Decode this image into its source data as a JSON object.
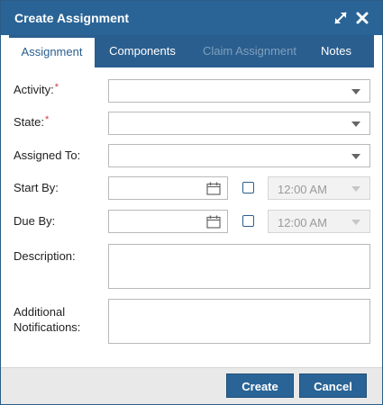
{
  "dialog": {
    "title": "Create Assignment"
  },
  "icons": {
    "maximize": "maximize-icon",
    "close": "close-icon",
    "calendar": "calendar-icon",
    "dropdown": "chevron-down-icon"
  },
  "tabs": [
    {
      "label": "Assignment",
      "state": "active"
    },
    {
      "label": "Components",
      "state": "normal"
    },
    {
      "label": "Claim Assignment",
      "state": "disabled"
    },
    {
      "label": "Notes",
      "state": "normal"
    }
  ],
  "form": {
    "activity": {
      "label": "Activity:",
      "required": "*",
      "value": ""
    },
    "state": {
      "label": "State:",
      "required": "*",
      "value": ""
    },
    "assigned_to": {
      "label": "Assigned To:",
      "value": ""
    },
    "start_by": {
      "label": "Start By:",
      "date": "",
      "time": "12:00 AM"
    },
    "due_by": {
      "label": "Due By:",
      "date": "",
      "time": "12:00 AM"
    },
    "description": {
      "label": "Description:",
      "value": ""
    },
    "additional_notifications": {
      "label_line1": "Additional",
      "label_line2": "Notifications:",
      "value": ""
    }
  },
  "buttons": {
    "create": "Create",
    "cancel": "Cancel"
  },
  "colors": {
    "primary": "#2a6496",
    "required": "#d63a3a"
  }
}
